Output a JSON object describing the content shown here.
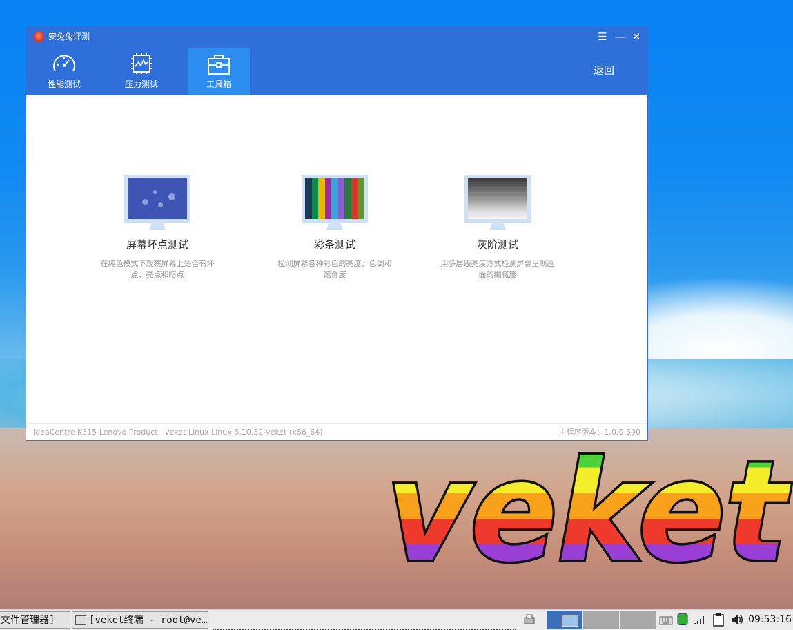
{
  "window": {
    "title": "安兔兔评测",
    "tabs": [
      {
        "label": "性能测试",
        "icon": "speedometer-icon"
      },
      {
        "label": "压力测试",
        "icon": "chip-chart-icon"
      },
      {
        "label": "工具箱",
        "icon": "toolbox-icon",
        "active": true
      }
    ],
    "back_label": "返回",
    "controls": {
      "menu": "☰",
      "minimize": "—",
      "close": "✕"
    }
  },
  "tools": [
    {
      "title": "屏幕坏点测试",
      "desc": "在纯色模式下观察屏幕上是否有坏点、亮点和暗点",
      "icon": "dead-pixel-monitor-icon"
    },
    {
      "title": "彩条测试",
      "desc": "检测屏幕各种彩色的亮度、色调和饱合度",
      "icon": "color-bars-monitor-icon"
    },
    {
      "title": "灰阶测试",
      "desc": "用多层级亮度方式检测屏幕呈现画面的细腻度",
      "icon": "grayscale-monitor-icon"
    }
  ],
  "footer": {
    "device": "IdeaCentre K315 Lenovo Product",
    "os": "veket Linux Linux:5.10.32-veket (x86_64)",
    "version": "主程序版本：1.0.0.590"
  },
  "desktop": {
    "logo_text": "veket"
  },
  "taskbar": {
    "file_manager": "文件管理器]",
    "terminal": "[veket终端 - root@ve…",
    "clock": "09:53:16"
  },
  "colors": {
    "titlebar": "#2f6fd9",
    "active_tab": "#2c8cf0",
    "color_bars": [
      "#1d3b57",
      "#0c8a4e",
      "#e6b800",
      "#9b2a9b",
      "#3aa3d9",
      "#8a5fd0",
      "#2b7a3c",
      "#d33a2a",
      "#5a9a2a"
    ]
  }
}
